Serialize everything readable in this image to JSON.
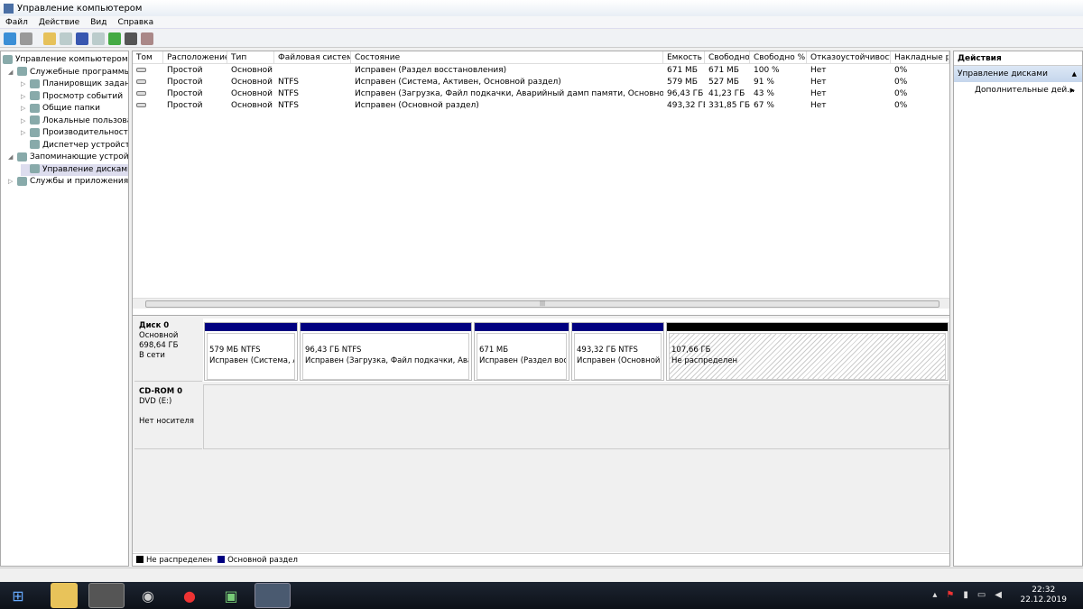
{
  "window": {
    "title": "Управление компьютером"
  },
  "menu": [
    "Файл",
    "Действие",
    "Вид",
    "Справка"
  ],
  "tree": [
    {
      "label": "Управление компьютером (л",
      "level": 0,
      "arrow": ""
    },
    {
      "label": "Служебные программы",
      "level": 1,
      "arrow": "◢"
    },
    {
      "label": "Планировщик заданий",
      "level": 2,
      "arrow": "▷"
    },
    {
      "label": "Просмотр событий",
      "level": 2,
      "arrow": "▷"
    },
    {
      "label": "Общие папки",
      "level": 2,
      "arrow": "▷"
    },
    {
      "label": "Локальные пользовате",
      "level": 2,
      "arrow": "▷"
    },
    {
      "label": "Производительность",
      "level": 2,
      "arrow": "▷"
    },
    {
      "label": "Диспетчер устройств",
      "level": 2,
      "arrow": ""
    },
    {
      "label": "Запоминающие устройст",
      "level": 1,
      "arrow": "◢"
    },
    {
      "label": "Управление дисками",
      "level": 2,
      "arrow": "",
      "selected": true
    },
    {
      "label": "Службы и приложения",
      "level": 1,
      "arrow": "▷"
    }
  ],
  "table": {
    "columns": [
      "Том",
      "Расположение",
      "Тип",
      "Файловая система",
      "Состояние",
      "Емкость",
      "Свободно",
      "Свободно %",
      "Отказоустойчивость",
      "Накладные рас"
    ],
    "rows": [
      [
        "",
        "Простой",
        "Основной",
        "",
        "Исправен (Раздел восстановления)",
        "671 МБ",
        "671 МБ",
        "100 %",
        "Нет",
        "0%"
      ],
      [
        "",
        "Простой",
        "Основной",
        "NTFS",
        "Исправен (Система, Активен, Основной раздел)",
        "579 МБ",
        "527 МБ",
        "91 %",
        "Нет",
        "0%"
      ],
      [
        "",
        "Простой",
        "Основной",
        "NTFS",
        "Исправен (Загрузка, Файл подкачки, Аварийный дамп памяти, Основной раздел)",
        "96,43 ГБ",
        "41,23 ГБ",
        "43 %",
        "Нет",
        "0%"
      ],
      [
        "",
        "Простой",
        "Основной",
        "NTFS",
        "Исправен (Основной раздел)",
        "493,32 ГБ",
        "331,85 ГБ",
        "67 %",
        "Нет",
        "0%"
      ]
    ]
  },
  "disks": [
    {
      "name": "Диск 0",
      "type": "Основной",
      "size": "698,64 ГБ",
      "status": "В сети",
      "partitions": [
        {
          "size": "579 МБ NTFS",
          "status": "Исправен (Система, Ак",
          "kind": "primary"
        },
        {
          "size": "96,43 ГБ NTFS",
          "status": "Исправен (Загрузка, Файл подкачки, Авари",
          "kind": "primary"
        },
        {
          "size": "671 МБ",
          "status": "Исправен (Раздел восст",
          "kind": "primary"
        },
        {
          "size": "493,32 ГБ NTFS",
          "status": "Исправен (Основной раздел)",
          "kind": "primary"
        },
        {
          "size": "107,66 ГБ",
          "status": "Не распределен",
          "kind": "unallocated"
        }
      ]
    },
    {
      "name": "CD-ROM 0",
      "type": "DVD (E:)",
      "size": "",
      "status": "Нет носителя"
    }
  ],
  "legend": [
    {
      "label": "Не распределен",
      "color": "#000000"
    },
    {
      "label": "Основной раздел",
      "color": "#000080"
    }
  ],
  "actions": {
    "header": "Действия",
    "group": "Управление дисками",
    "item": "Дополнительные дей..."
  },
  "clock": {
    "time": "22:32",
    "date": "22.12.2019"
  }
}
